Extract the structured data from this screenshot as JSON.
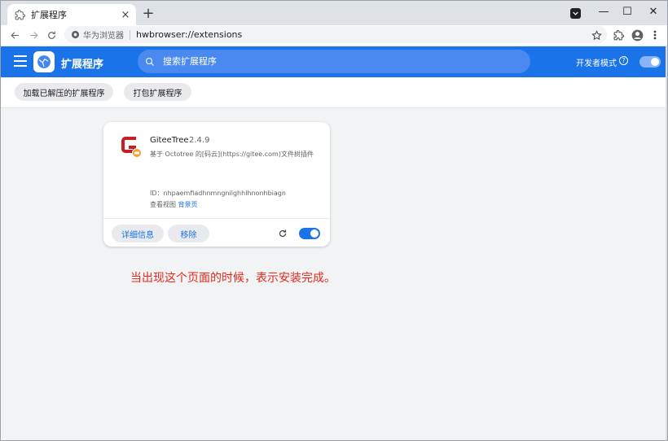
{
  "browser": {
    "tab": {
      "title": "扩展程序",
      "close_icon": "×"
    },
    "new_tab_icon": "+",
    "window_controls": {
      "minimize": "—",
      "maximize": "☐",
      "close": "✕"
    },
    "site_label": "华为浏览器",
    "url": "hwbrowser://extensions"
  },
  "extensions_page": {
    "header_title": "扩展程序",
    "search_placeholder": "搜索扩展程序",
    "developer_mode_label": "开发者模式",
    "developer_mode_on": true,
    "help_glyph": "?",
    "buttons": {
      "load_unpacked": "加载已解压的扩展程序",
      "pack": "打包扩展程序"
    }
  },
  "extension_card": {
    "name": "GiteeTree",
    "version": "2.4.9",
    "description": "基于 Octotree 的[码云](https://gitee.com)文件树插件",
    "id_text": "ID：nhpaemfiadhnmngnilghhlhnonhbiagn",
    "views_label": "查看视图",
    "views_link": "背景页",
    "details_button": "详细信息",
    "remove_button": "移除",
    "enabled": true
  },
  "notice_text": "当出现这个页面的时候，表示安装完成。",
  "colors": {
    "accent": "#1a73e8",
    "notice": "#e8281c",
    "gitee_red": "#c71d23"
  }
}
